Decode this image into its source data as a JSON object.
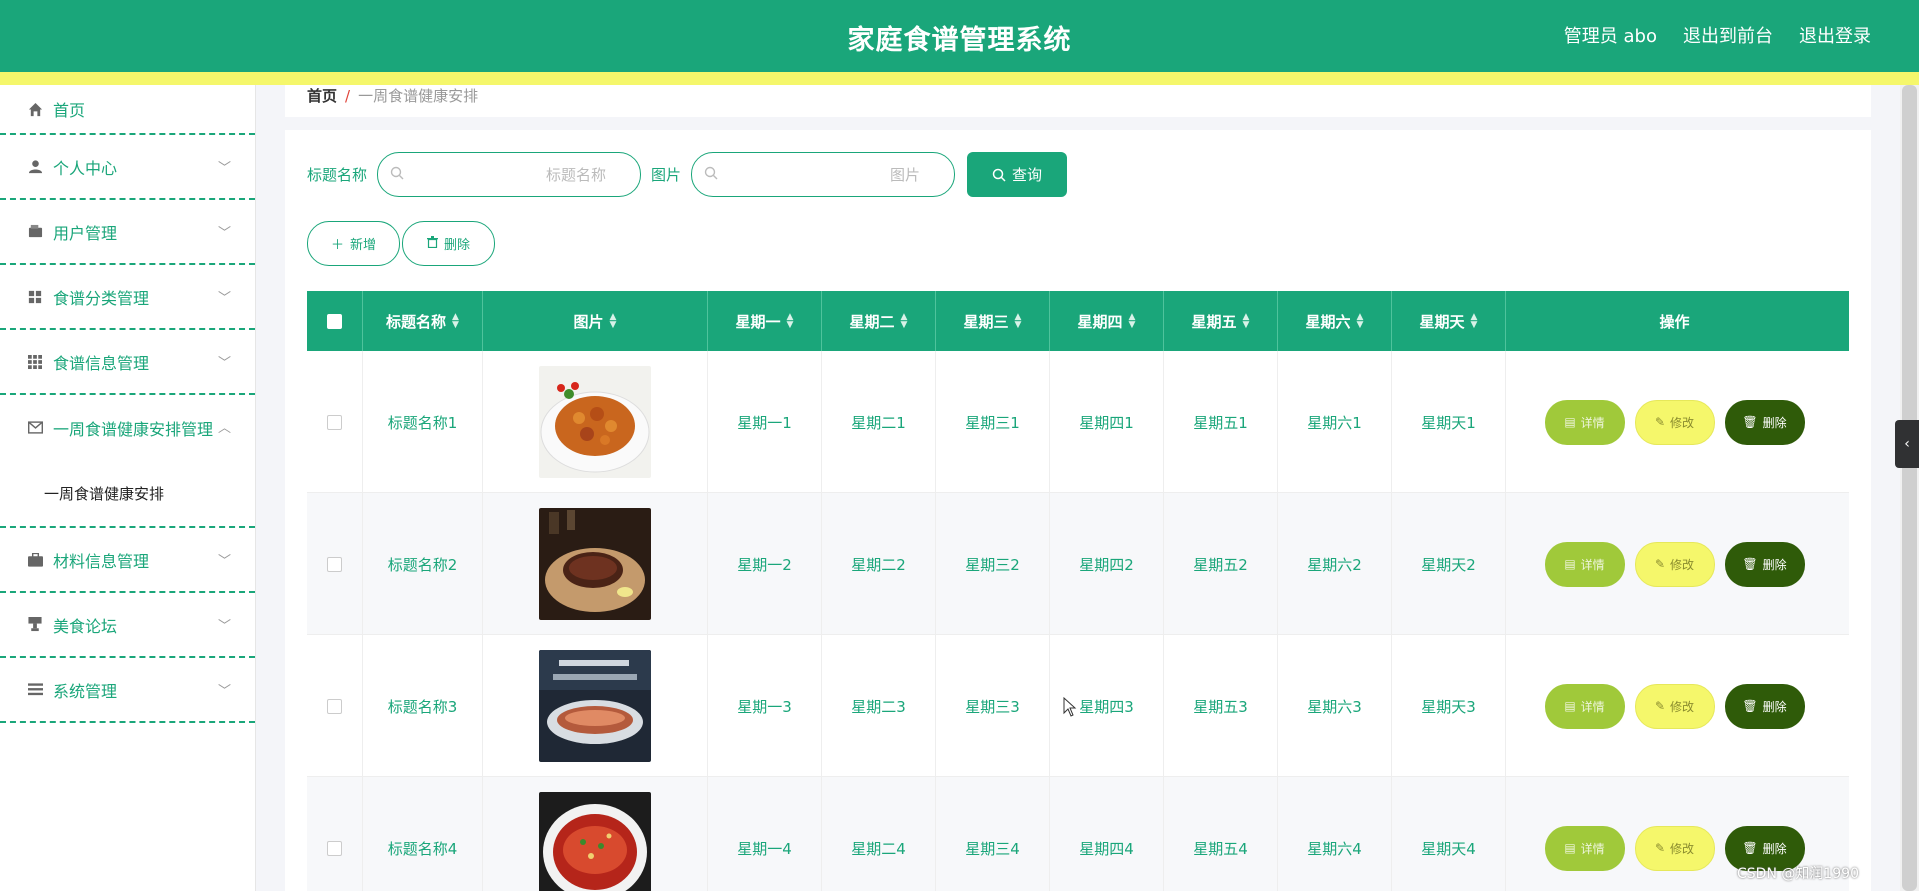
{
  "header": {
    "title": "家庭食谱管理系统",
    "links": [
      "管理员 abo",
      "退出到前台",
      "退出登录"
    ]
  },
  "sidebar": {
    "items": [
      {
        "label": "首页",
        "icon": "home-icon"
      },
      {
        "label": "个人中心",
        "icon": "user-icon"
      },
      {
        "label": "用户管理",
        "icon": "wallet-icon"
      },
      {
        "label": "食谱分类管理",
        "icon": "grid-icon"
      },
      {
        "label": "食谱信息管理",
        "icon": "apps-icon"
      },
      {
        "label": "一周食谱健康安排管理",
        "icon": "mail-icon"
      },
      {
        "label": "材料信息管理",
        "icon": "briefcase-icon"
      },
      {
        "label": "美食论坛",
        "icon": "trophy-icon"
      },
      {
        "label": "系统管理",
        "icon": "list-icon"
      }
    ],
    "submenu": "一周食谱健康安排"
  },
  "breadcrumb": {
    "home": "首页",
    "separator": "/",
    "current": "一周食谱健康安排"
  },
  "search": {
    "title_label": "标题名称",
    "title_placeholder": "标题名称",
    "image_label": "图片",
    "image_placeholder": "图片",
    "query_label": "查询"
  },
  "actions": {
    "add_label": "新增",
    "delete_label": "删除"
  },
  "table": {
    "headers": [
      "标题名称",
      "图片",
      "星期一",
      "星期二",
      "星期三",
      "星期四",
      "星期五",
      "星期六",
      "星期天",
      "操作"
    ],
    "rows": [
      {
        "title": "标题名称1",
        "mon": "星期一1",
        "tue": "星期二1",
        "wed": "星期三1",
        "thu": "星期四1",
        "fri": "星期五1",
        "sat": "星期六1",
        "sun": "星期天1"
      },
      {
        "title": "标题名称2",
        "mon": "星期一2",
        "tue": "星期二2",
        "wed": "星期三2",
        "thu": "星期四2",
        "fri": "星期五2",
        "sat": "星期六2",
        "sun": "星期天2"
      },
      {
        "title": "标题名称3",
        "mon": "星期一3",
        "tue": "星期二3",
        "wed": "星期三3",
        "thu": "星期四3",
        "fri": "星期五3",
        "sat": "星期六3",
        "sun": "星期天3"
      },
      {
        "title": "标题名称4",
        "mon": "星期一4",
        "tue": "星期二4",
        "wed": "星期三4",
        "thu": "星期四4",
        "fri": "星期五4",
        "sat": "星期六4",
        "sun": "星期天4"
      }
    ],
    "ops": {
      "detail": "详情",
      "edit": "修改",
      "delete": "删除"
    }
  },
  "watermark": "CSDN @知润1990",
  "colors": {
    "primary": "#1aa67a",
    "accent_yellow": "#f5f76b",
    "detail": "#a0c93a",
    "delete": "#2f5b09"
  }
}
